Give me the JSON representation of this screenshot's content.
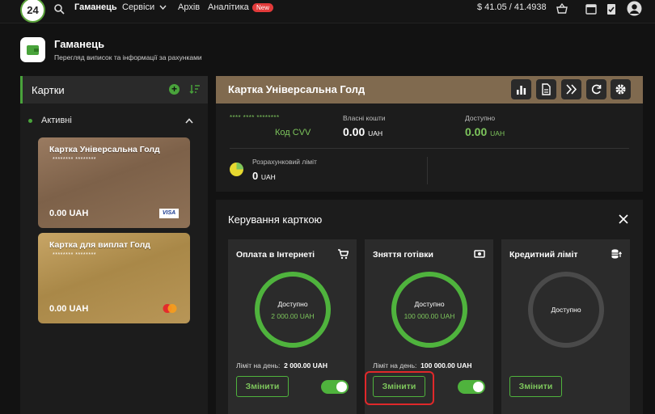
{
  "nav": {
    "logo": "24",
    "items": [
      {
        "label": "Гаманець",
        "active": true
      },
      {
        "label": "Сервіси"
      },
      {
        "label": "Архів"
      },
      {
        "label": "Аналітика"
      }
    ],
    "new_badge": "New",
    "rate": "$  41.05 / 41.4938"
  },
  "header": {
    "title": "Гаманець",
    "subtitle": "Перегляд виписок та інформації за рахунками"
  },
  "left": {
    "title": "Картки",
    "section": "Активні",
    "cards": [
      {
        "name": "Картка Універсальна Голд",
        "number": "******** ********",
        "amount": "0.00 UAH",
        "brand": "VISA"
      },
      {
        "name": "Картка для виплат Голд",
        "number": "******** ********",
        "amount": "0.00 UAH",
        "brand": "mastercard"
      }
    ]
  },
  "detail": {
    "title": "Картка Універсальна Голд",
    "masked": "**** **** ********",
    "cvv_label": "Код CVV",
    "own_funds_label": "Власні кошти",
    "own_funds_value": "0.00",
    "available_label": "Доступно",
    "available_value": "0.00",
    "calc_limit_label": "Розрахунковий ліміт",
    "calc_limit_value": "0",
    "currency": "UAH"
  },
  "manage": {
    "title": "Керування карткою",
    "limits": [
      {
        "title": "Оплата в Інтернеті",
        "icon": "cart-icon",
        "ring_label": "Доступно",
        "ring_value": "2 000.00 UAH",
        "day_label": "Ліміт на день:",
        "day_value": "2 000.00 UAH",
        "button": "Змінити",
        "enabled": true
      },
      {
        "title": "Зняття готівки",
        "icon": "cash-icon",
        "ring_label": "Доступно",
        "ring_value": "100 000.00 UAH",
        "day_label": "Ліміт на день:",
        "day_value": "100 000.00 UAH",
        "button": "Змінити",
        "enabled": true
      },
      {
        "title": "Кредитний ліміт",
        "icon": "coins-icon",
        "ring_label": "Доступно",
        "button": "Змінити"
      }
    ]
  },
  "colors": {
    "accent": "#4fb33d",
    "highlight": "#e0282a",
    "header_gold": "#806a4f"
  }
}
